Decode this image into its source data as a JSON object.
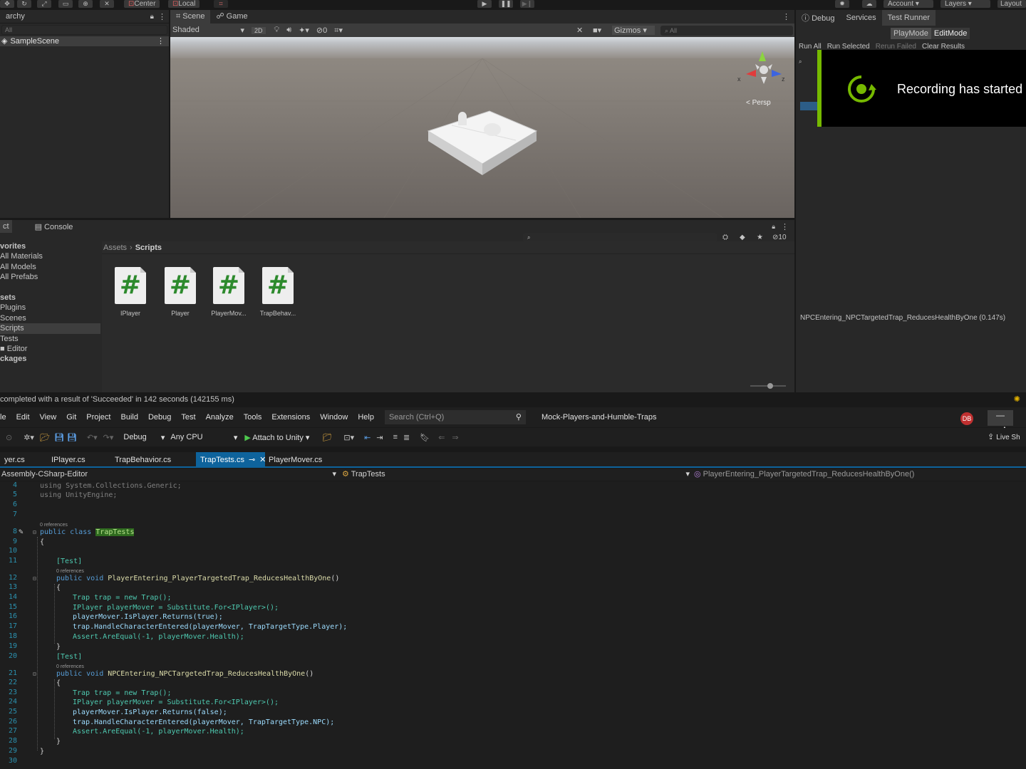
{
  "toolbar": {
    "center": "Center",
    "local": "Local",
    "account": "Account",
    "layers": "Layers",
    "layout": "Layout"
  },
  "hierarchy": {
    "tab": "archy",
    "search_placeholder": "All",
    "scene_name": "SampleScene"
  },
  "scene": {
    "tabs": [
      "Scene",
      "Game"
    ],
    "shading": "Shaded",
    "mode_2d": "2D",
    "gizmos": "Gizmos",
    "search_placeholder": "All",
    "hidden_count": "0",
    "persp_label": "< Persp",
    "axis_x": "x",
    "axis_z": "z"
  },
  "testrunner": {
    "tabs": [
      "Debug",
      "Services",
      "Test Runner"
    ],
    "modes": [
      "PlayMode",
      "EditMode"
    ],
    "actions": [
      "Run All",
      "Run Selected",
      "Rerun Failed",
      "Clear Results"
    ],
    "result_line": "NPCEntering_NPCTargetedTrap_ReducesHealthByOne (0.147s)"
  },
  "recording": {
    "text": "Recording has started"
  },
  "project": {
    "tabs": [
      "ct",
      "Console"
    ],
    "hidden_count": "10",
    "breadcrumb": [
      "Assets",
      "Scripts"
    ],
    "sidebar": [
      "vorites",
      "All Materials",
      "All Models",
      "All Prefabs",
      "",
      "sets",
      "Plugins",
      "Scenes",
      "Scripts",
      "Tests",
      "Editor",
      "ckages"
    ],
    "assets": [
      "IPlayer",
      "Player",
      "PlayerMov...",
      "TrapBehav..."
    ],
    "asset_glyph": "#"
  },
  "status": {
    "message": "completed with a result of 'Succeeded' in 142 seconds (142155 ms)"
  },
  "vs": {
    "menu": [
      "le",
      "Edit",
      "View",
      "Git",
      "Project",
      "Build",
      "Debug",
      "Test",
      "Analyze",
      "Tools",
      "Extensions",
      "Window",
      "Help"
    ],
    "search_placeholder": "Search (Ctrl+Q)",
    "solution": "Mock-Players-and-Humble-Traps",
    "avatar": "DB",
    "config": "Debug",
    "platform": "Any CPU",
    "attach": "Attach to Unity",
    "live_share": "Live Sh",
    "tabs": [
      "yer.cs",
      "IPlayer.cs",
      "TrapBehavior.cs",
      "TrapTests.cs",
      "PlayerMover.cs"
    ],
    "nav_project": "Assembly-CSharp-Editor",
    "nav_class": "TrapTests",
    "nav_member": "PlayerEntering_PlayerTargetedTrap_ReducesHealthByOne()"
  },
  "code": {
    "line_numbers": [
      "4",
      "5",
      "6",
      "7",
      "8",
      "9",
      "10",
      "11",
      "12",
      "13",
      "14",
      "15",
      "16",
      "17",
      "18",
      "19",
      "20",
      "21",
      "22",
      "23",
      "24",
      "25",
      "26",
      "27",
      "28",
      "29",
      "30"
    ],
    "refs0": "0 references",
    "refs1": "0 references",
    "refs2": "0 references",
    "l4a": "using",
    "l4b": " System.Collections.Generic;",
    "l5a": "using",
    "l5b": " UnityEngine;",
    "l8a": "public class ",
    "l8b": "TrapTests",
    "l9": "{",
    "l11": "[Test]",
    "l12a": "public void ",
    "l12b": "PlayerEntering_PlayerTargetedTrap_ReducesHealthByOne",
    "l12c": "()",
    "l13": "{",
    "l14": "Trap trap = new Trap();",
    "l15": "IPlayer playerMover = Substitute.For<IPlayer>();",
    "l16": "playerMover.IsPlayer.Returns(true);",
    "l17": "trap.HandleCharacterEntered(playerMover, TrapTargetType.Player);",
    "l18": "Assert.AreEqual(-1, playerMover.Health);",
    "l19": "}",
    "l20": "[Test]",
    "l21a": "public void ",
    "l21b": "NPCEntering_NPCTargetedTrap_ReducesHealthByOne",
    "l21c": "()",
    "l22": "{",
    "l23": "Trap trap = new Trap();",
    "l24": "IPlayer playerMover = Substitute.For<IPlayer>();",
    "l25": "playerMover.IsPlayer.Returns(false);",
    "l26": "trap.HandleCharacterEntered(playerMover, TrapTargetType.NPC);",
    "l27": "Assert.AreEqual(-1, playerMover.Health);",
    "l28": "}",
    "l29": "}"
  }
}
